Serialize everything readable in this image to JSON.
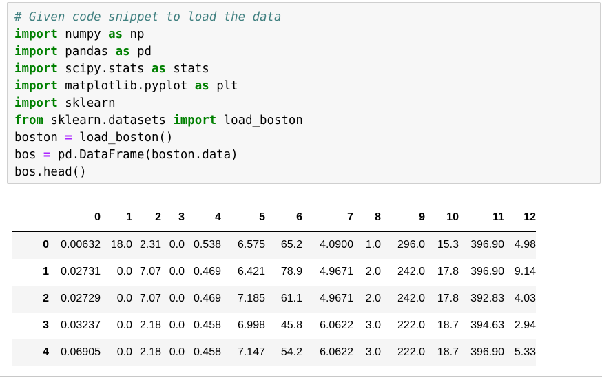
{
  "code_cell": {
    "lines": [
      [
        {
          "c": "cm",
          "t": "# Given code snippet to load the data"
        }
      ],
      [
        {
          "c": "kw",
          "t": "import"
        },
        {
          "c": "tx",
          "t": " numpy "
        },
        {
          "c": "kw",
          "t": "as"
        },
        {
          "c": "tx",
          "t": " np"
        }
      ],
      [
        {
          "c": "kw",
          "t": "import"
        },
        {
          "c": "tx",
          "t": " pandas "
        },
        {
          "c": "kw",
          "t": "as"
        },
        {
          "c": "tx",
          "t": " pd"
        }
      ],
      [
        {
          "c": "kw",
          "t": "import"
        },
        {
          "c": "tx",
          "t": " scipy.stats "
        },
        {
          "c": "kw",
          "t": "as"
        },
        {
          "c": "tx",
          "t": " stats"
        }
      ],
      [
        {
          "c": "kw",
          "t": "import"
        },
        {
          "c": "tx",
          "t": " matplotlib.pyplot "
        },
        {
          "c": "kw",
          "t": "as"
        },
        {
          "c": "tx",
          "t": " plt"
        }
      ],
      [
        {
          "c": "kw",
          "t": "import"
        },
        {
          "c": "tx",
          "t": " sklearn"
        }
      ],
      [
        {
          "c": "kw",
          "t": "from"
        },
        {
          "c": "tx",
          "t": " sklearn.datasets "
        },
        {
          "c": "kw",
          "t": "import"
        },
        {
          "c": "tx",
          "t": " load_boston"
        }
      ],
      [
        {
          "c": "tx",
          "t": "boston "
        },
        {
          "c": "op",
          "t": "="
        },
        {
          "c": "tx",
          "t": " load_boston()"
        }
      ],
      [
        {
          "c": "tx",
          "t": "bos "
        },
        {
          "c": "op",
          "t": "="
        },
        {
          "c": "tx",
          "t": " pd.DataFrame(boston.data)"
        }
      ],
      [
        {
          "c": "tx",
          "t": "bos.head()"
        }
      ]
    ]
  },
  "output_table": {
    "columns": [
      "0",
      "1",
      "2",
      "3",
      "4",
      "5",
      "6",
      "7",
      "8",
      "9",
      "10",
      "11",
      "12"
    ],
    "rows": [
      {
        "index": "0",
        "cells": [
          "0.00632",
          "18.0",
          "2.31",
          "0.0",
          "0.538",
          "6.575",
          "65.2",
          "4.0900",
          "1.0",
          "296.0",
          "15.3",
          "396.90",
          "4.98"
        ]
      },
      {
        "index": "1",
        "cells": [
          "0.02731",
          "0.0",
          "7.07",
          "0.0",
          "0.469",
          "6.421",
          "78.9",
          "4.9671",
          "2.0",
          "242.0",
          "17.8",
          "396.90",
          "9.14"
        ]
      },
      {
        "index": "2",
        "cells": [
          "0.02729",
          "0.0",
          "7.07",
          "0.0",
          "0.469",
          "7.185",
          "61.1",
          "4.9671",
          "2.0",
          "242.0",
          "17.8",
          "392.83",
          "4.03"
        ]
      },
      {
        "index": "3",
        "cells": [
          "0.03237",
          "0.0",
          "2.18",
          "0.0",
          "0.458",
          "6.998",
          "45.8",
          "6.0622",
          "3.0",
          "222.0",
          "18.7",
          "394.63",
          "2.94"
        ]
      },
      {
        "index": "4",
        "cells": [
          "0.06905",
          "0.0",
          "2.18",
          "0.0",
          "0.458",
          "7.147",
          "54.2",
          "6.0622",
          "3.0",
          "222.0",
          "18.7",
          "396.90",
          "5.33"
        ]
      }
    ]
  }
}
